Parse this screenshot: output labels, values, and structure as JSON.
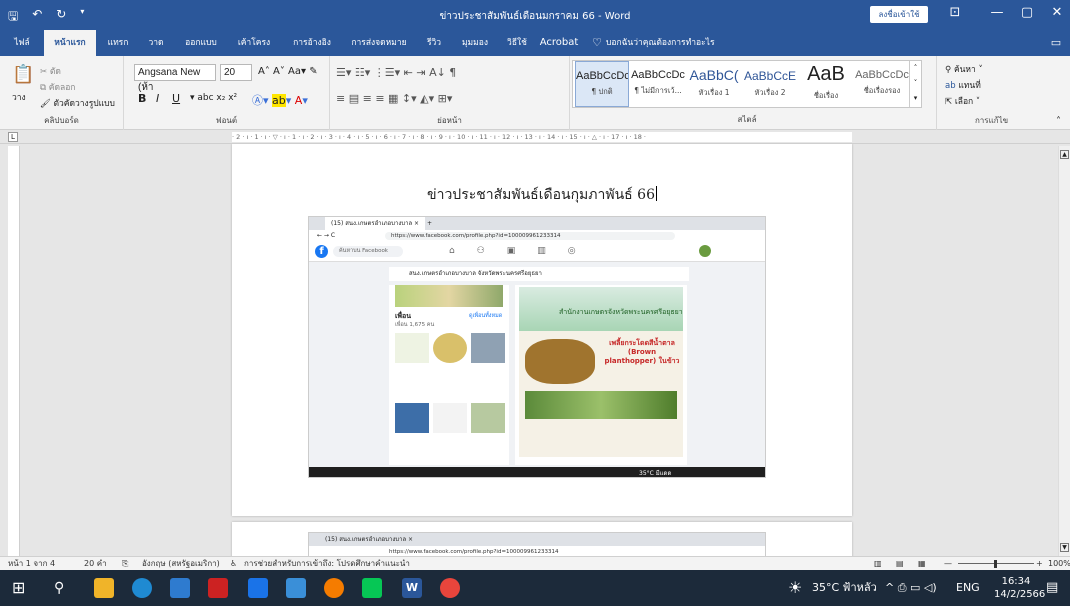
{
  "window": {
    "title": "ข่าวประชาสัมพันธ์เดือนมกราคม 66  -  Word",
    "signin_label": "ลงชื่อเข้าใช้",
    "minimize": "—",
    "restore": "▢",
    "close": "✕"
  },
  "ribbon_tabs": [
    "ไฟล์",
    "หน้าแรก",
    "แทรก",
    "วาด",
    "ออกแบบ",
    "เค้าโครง",
    "การอ้างอิง",
    "การส่งจดหมาย",
    "รีวิว",
    "มุมมอง",
    "วิธีใช้",
    "Acrobat"
  ],
  "tell_me": "บอกฉันว่าคุณต้องการทำอะไร",
  "clipboard": {
    "cut": "ตัด",
    "copy": "คัดลอก",
    "paste": "วาง",
    "format_painter": "ตัวคัดวางรูปแบบ",
    "label": "คลิปบอร์ด"
  },
  "font": {
    "name": "Angsana New (ห้า",
    "size": "20",
    "label": "ฟอนต์"
  },
  "paragraph": {
    "label": "ย่อหน้า"
  },
  "styles": {
    "label": "สไตล์",
    "items": [
      {
        "preview": "AaBbCcDc",
        "name": "¶ ปกติ"
      },
      {
        "preview": "AaBbCcDc",
        "name": "¶ ไม่มีการเว้..."
      },
      {
        "preview": "AaBbC(",
        "name": "หัวเรื่อง 1"
      },
      {
        "preview": "AaBbCcE",
        "name": "หัวเรื่อง 2"
      },
      {
        "preview": "AaB",
        "name": "ชื่อเรื่อง"
      },
      {
        "preview": "AaBbCcDc",
        "name": "ชื่อเรื่องรอง"
      }
    ]
  },
  "editing": {
    "find": "ค้นหา",
    "replace": "แทนที่",
    "select": "เลือก",
    "label": "การแก้ไข"
  },
  "ruler_scale": "· 2 · ı · 1 · ı · ▽ · ı · 1 · ı · 2 · ı · 3 · ı · 4 · ı · 5 · ı · 6 · ı · 7 · ı · 8 · ı · 9 · ı · 10 · ı · 11 · ı · 12 · ı · 13 · ı · 14 · ı · 15 · ı · △ · ı · 17 · ı · 18 ·",
  "document": {
    "headline": "ข่าวประชาสัมพันธ์เดือนกุมภาพันธ์ 66"
  },
  "embedded_screenshot": {
    "tab_title": "(15) สนง.เกษตรอำเภอบางบาล  ×",
    "url": "https://www.facebook.com/profile.php?id=100009961233314",
    "fb_search": "ค้นหาบน Facebook",
    "page_header": "สนง.เกษตรอำเภอบางบาล จังหวัดพระนครศรีอยุธยา",
    "friends_heading": "เพื่อน",
    "friends_count": "เพื่อน 1,675 คน",
    "see_all": "ดูเพื่อนทั้งหมด",
    "poster_office": "สำนักงานเกษตรจังหวัดพระนครศรีอยุธยา",
    "poster_title": "เพลี้ยกระโดดสีน้ำตาล (Brown planthopper) ในข้าว",
    "taskbar_temp": "35°C มีแดด"
  },
  "status": {
    "page": "หน้า 1 จาก 4",
    "words": "20 คำ",
    "language": "อังกฤษ (สหรัฐอเมริกา)",
    "accessibility": "การช่วยสำหรับการเข้าถึง: โปรดศึกษาคำแนะนำ",
    "zoom": "100%"
  },
  "taskbar": {
    "weather": "35°C ฟ้าหลัว",
    "lang": "ENG",
    "time": "16:34",
    "date": "14/2/2566"
  }
}
